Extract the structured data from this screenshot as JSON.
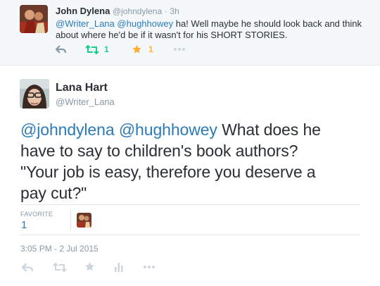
{
  "parent_tweet": {
    "name": "John Dylena",
    "handle": "@johndylena",
    "separator": "·",
    "time": "3h",
    "mention1": "@Writer_Lana",
    "mention2": "@hughhowey",
    "text_line1": " ha! Well maybe he should look back and think",
    "text_line2": "about where he'd be if it wasn't for his SHORT STORIES.",
    "retweet_count": "1",
    "favorite_count": "1"
  },
  "tweet": {
    "name": "Lana Hart",
    "handle": "@Writer_Lana",
    "mention1": "@johndylena",
    "mention2": "@hughhowey",
    "text_line1_rest": " What does he",
    "text_line2": "have to say to children's book authors?",
    "text_line3": "\"Your job is easy, therefore you deserve a",
    "text_line4": "pay cut?\"",
    "favorite_label": "FAVORITE",
    "favorite_count": "1",
    "timestamp": "3:05 PM - 2 Jul 2015"
  },
  "colors": {
    "link": "#2b7bb9",
    "retweet_green": "#19cf86",
    "favorite_gold": "#ffac33",
    "muted": "#8899a6",
    "icon_gray": "#ccd6dd"
  },
  "icons": [
    "reply-icon",
    "retweet-icon",
    "favorite-icon",
    "more-icon",
    "stats-icon"
  ]
}
